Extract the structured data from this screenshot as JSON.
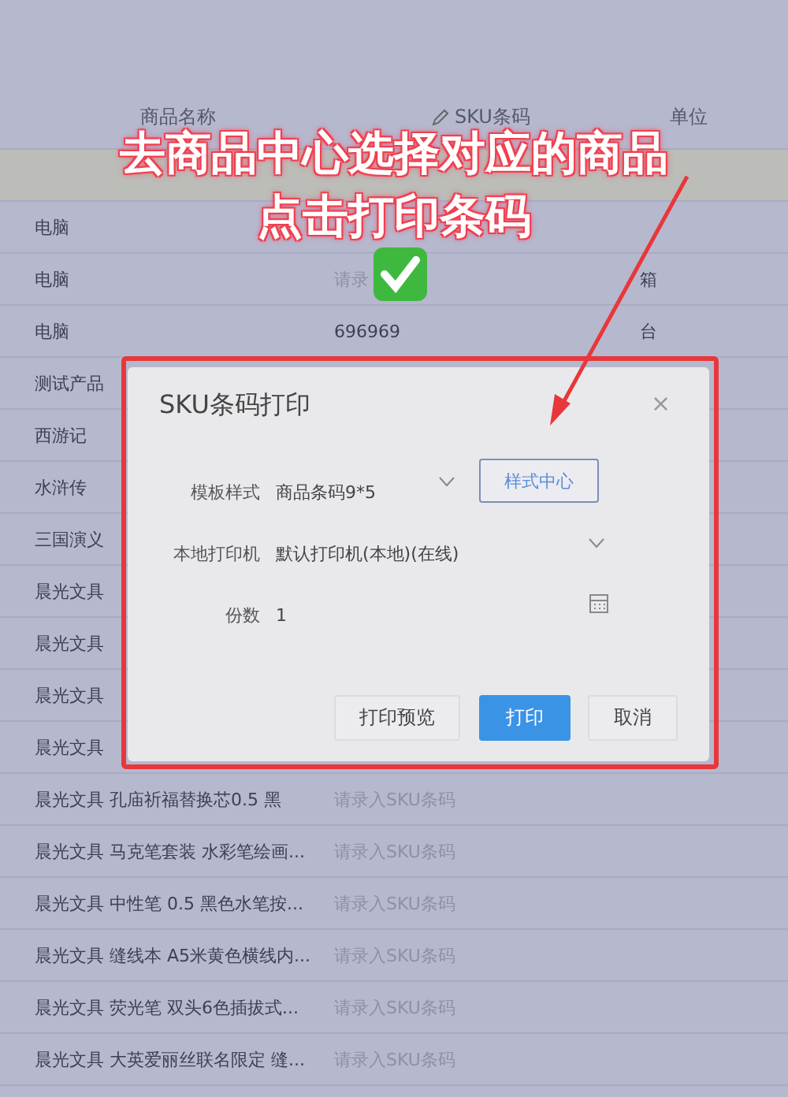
{
  "table": {
    "columns": [
      "商品名称",
      "SKU条码",
      "单位"
    ],
    "rows": [
      {
        "name": "电脑"
      },
      {
        "name": "电脑",
        "sku_placeholder": "请录",
        "unit": "箱"
      },
      {
        "name": "电脑",
        "sku": "696969",
        "unit": "台"
      },
      {
        "name": "测试产品"
      },
      {
        "name": "西游记"
      },
      {
        "name": "水浒传"
      },
      {
        "name": "三国演义"
      },
      {
        "name": "晨光文具"
      },
      {
        "name": "晨光文具"
      },
      {
        "name": "晨光文具"
      },
      {
        "name": "晨光文具"
      },
      {
        "name": "晨光文具 孔庙祈福替换芯0.5 黑",
        "sku_placeholder": "请录入SKU条码"
      },
      {
        "name": "晨光文具 马克笔套装 水彩笔绘画...",
        "sku_placeholder": "请录入SKU条码"
      },
      {
        "name": "晨光文具 中性笔 0.5 黑色水笔按...",
        "sku_placeholder": "请录入SKU条码"
      },
      {
        "name": "晨光文具 缝线本 A5米黄色横线内...",
        "sku_placeholder": "请录入SKU条码"
      },
      {
        "name": "晨光文具 荧光笔 双头6色插拔式...",
        "sku_placeholder": "请录入SKU条码"
      },
      {
        "name": "晨光文具 大英爱丽丝联名限定 缝...",
        "sku_placeholder": "请录入SKU条码"
      }
    ]
  },
  "dialog": {
    "title": "SKU条码打印",
    "close": "×",
    "fields": [
      {
        "kind": "select",
        "label": "模板样式",
        "value": "商品条码9*5",
        "button": "样式中心"
      },
      {
        "kind": "select",
        "label": "本地打印机",
        "value": "默认打印机(本地)(在线)"
      },
      {
        "kind": "number",
        "label": "份数",
        "value": "1"
      }
    ],
    "buttons": [
      {
        "label": "打印预览",
        "primary": false
      },
      {
        "label": "打印",
        "primary": true
      },
      {
        "label": "取消",
        "primary": false
      }
    ]
  },
  "caption": [
    "去商品中心选择对应的商品",
    "点击打印条码"
  ]
}
